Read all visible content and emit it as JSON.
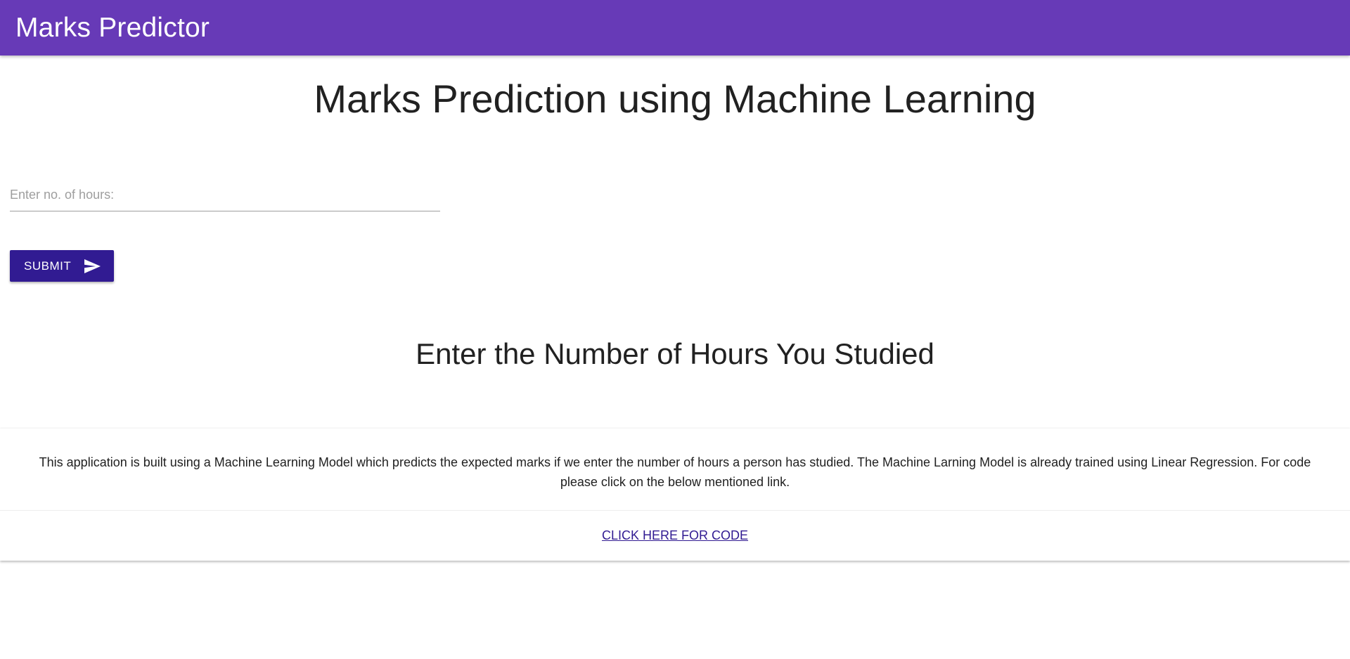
{
  "navbar": {
    "brand": "Marks Predictor",
    "color": "#673ab7"
  },
  "main": {
    "title": "Marks Prediction using Machine Learning",
    "hours_input": {
      "placeholder": "Enter no. of hours:",
      "value": ""
    },
    "submit": {
      "label": "SUBMIT",
      "icon": "send-icon",
      "color": "#311b92"
    },
    "result": "Enter the Number of Hours You Studied"
  },
  "info_card": {
    "description": "This application is built using a Machine Learning Model which predicts the expected marks if we enter the number of hours a person has studied. The Machine Larning Model is already trained using Linear Regression. For code please click on the below mentioned link.",
    "link_label": "CLICK HERE FOR CODE"
  }
}
